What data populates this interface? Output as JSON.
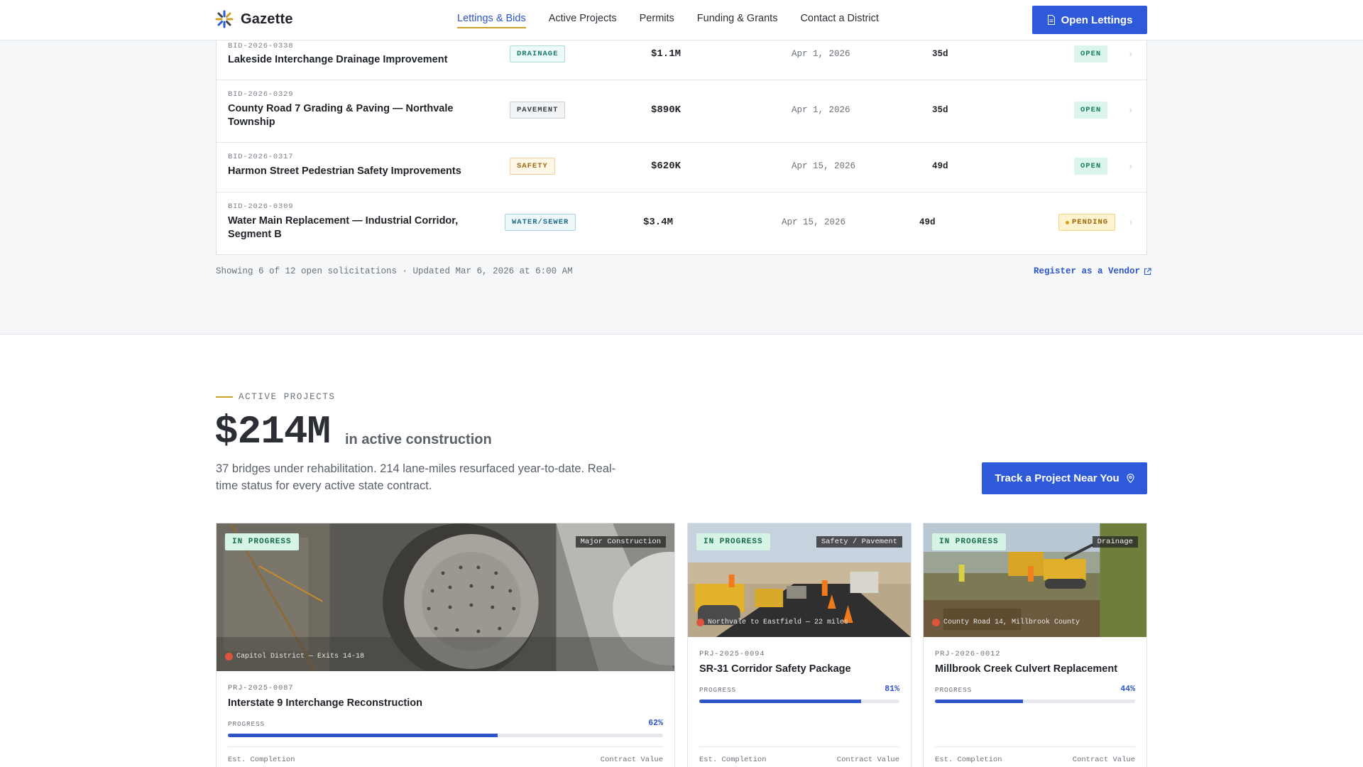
{
  "header": {
    "brand": "Gazette",
    "nav": [
      "Lettings & Bids",
      "Active Projects",
      "Permits",
      "Funding & Grants",
      "Contact a District"
    ],
    "cta": "Open Lettings"
  },
  "bids": {
    "rows": [
      {
        "id": "BID-2026-0338",
        "title": "Lakeside Interchange Drainage Improvement",
        "category": "DRAINAGE",
        "value": "$1.1M",
        "date": "Apr 1, 2026",
        "days": "35d",
        "status": "OPEN"
      },
      {
        "id": "BID-2026-0329",
        "title": "County Road 7 Grading & Paving — Northvale Township",
        "category": "PAVEMENT",
        "value": "$890K",
        "date": "Apr 1, 2026",
        "days": "35d",
        "status": "OPEN"
      },
      {
        "id": "BID-2026-0317",
        "title": "Harmon Street Pedestrian Safety Improvements",
        "category": "SAFETY",
        "value": "$620K",
        "date": "Apr 15, 2026",
        "days": "49d",
        "status": "OPEN"
      },
      {
        "id": "BID-2026-0309",
        "title": "Water Main Replacement — Industrial Corridor, Segment B",
        "category": "WATER/SEWER",
        "value": "$3.4M",
        "date": "Apr 15, 2026",
        "days": "49d",
        "status": "PENDING"
      }
    ],
    "footer": "Showing 6 of 12 open solicitations · Updated Mar 6, 2026 at 6:00 AM",
    "vendor_link": "Register as a Vendor"
  },
  "projects": {
    "eyebrow": "ACTIVE PROJECTS",
    "headline_value": "$214M",
    "headline_suffix": "in active construction",
    "description": "37 bridges under rehabilitation. 214 lane-miles resurfaced year-to-date. Real-time status for every active state contract.",
    "cta": "Track a Project Near You",
    "cards": [
      {
        "status": "IN PROGRESS",
        "type": "Major Construction",
        "location": "Capitol District — Exits 14-18",
        "id": "PRJ-2025-0087",
        "title": "Interstate 9 Interchange Reconstruction",
        "progress_label": "PROGRESS",
        "progress_text": "62%",
        "progress": 0.62,
        "meta_left": "Est. Completion",
        "meta_right": "Contract Value"
      },
      {
        "status": "IN PROGRESS",
        "type": "Safety / Pavement",
        "location": "Northvale to Eastfield — 22 miles",
        "id": "PRJ-2025-0094",
        "title": "SR-31 Corridor Safety Package",
        "progress_label": "PROGRESS",
        "progress_text": "81%",
        "progress": 0.81,
        "meta_left": "Est. Completion",
        "meta_right": "Contract Value"
      },
      {
        "status": "IN PROGRESS",
        "type": "Drainage",
        "location": "County Road 14, Millbrook County",
        "id": "PRJ-2026-0012",
        "title": "Millbrook Creek Culvert Replacement",
        "progress_label": "PROGRESS",
        "progress_text": "44%",
        "progress": 0.44,
        "meta_left": "Est. Completion",
        "meta_right": "Contract Value"
      }
    ]
  },
  "icons": {
    "logo": "starburst-logo-icon",
    "document": "document-icon",
    "external": "external-link-icon",
    "pin": "map-pin-icon",
    "chevron": "chevron-right-icon"
  },
  "colors": {
    "accent": "#2e59d9",
    "gold": "#c9a227",
    "open": "#18805a",
    "pending": "#9a6a06"
  }
}
